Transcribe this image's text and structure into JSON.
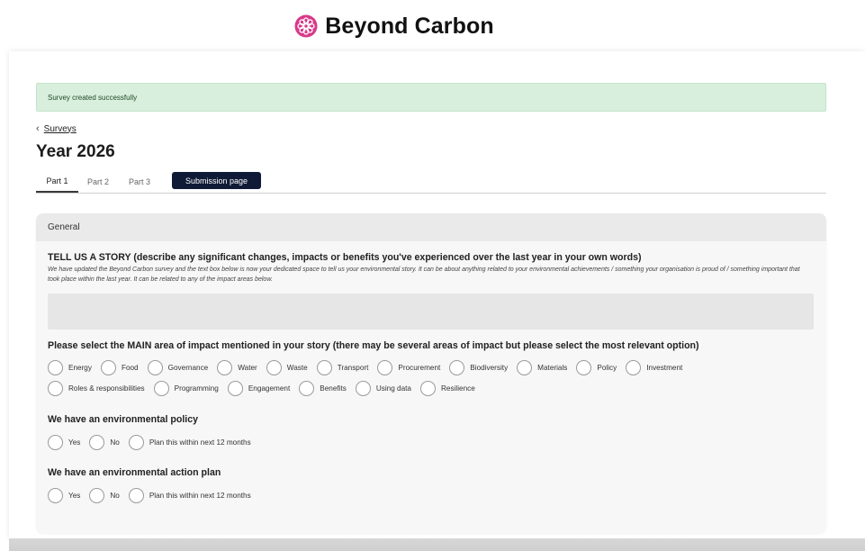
{
  "brand": {
    "name": "Beyond Carbon",
    "logo_color": "#d83a8a"
  },
  "alert": {
    "text": "Survey created successfully"
  },
  "breadcrumb": {
    "back_label": "Surveys"
  },
  "page": {
    "title": "Year 2026"
  },
  "tabs": [
    "Part 1",
    "Part 2",
    "Part 3",
    "Submission page"
  ],
  "section": {
    "title": "General"
  },
  "story": {
    "title": "TELL US A STORY (describe any significant changes, impacts or benefits you've experienced over the last year in your own words)",
    "description": "We have updated the Beyond Carbon survey and the text box below is now your dedicated space to tell us your environmental story. It can be about anything related to your environmental achievements / something your organisation is proud of / something important that took place within the last year. It can be related to any of the impact areas below.",
    "value": ""
  },
  "main_area": {
    "question": "Please select the MAIN area of impact mentioned in your story (there may be several areas of impact but please select the most relevant option)",
    "options_row1": [
      "Energy",
      "Food",
      "Governance",
      "Water",
      "Waste",
      "Transport",
      "Procurement",
      "Biodiversity",
      "Materials",
      "Policy",
      "Investment"
    ],
    "options_row2": [
      "Roles & responsibilities",
      "Programming",
      "Engagement",
      "Benefits",
      "Using data",
      "Resilience"
    ]
  },
  "env_policy": {
    "question": "We have an environmental policy",
    "options": [
      "Yes",
      "No",
      "Plan this within next 12 months"
    ]
  },
  "env_action_plan": {
    "question": "We have an environmental action plan",
    "options": [
      "Yes",
      "No",
      "Plan this within next 12 months"
    ]
  },
  "colors": {
    "alert_bg": "#d9efdd",
    "active_tab_bg": "#0f1a36",
    "panel_bg": "#f7f7f7"
  }
}
